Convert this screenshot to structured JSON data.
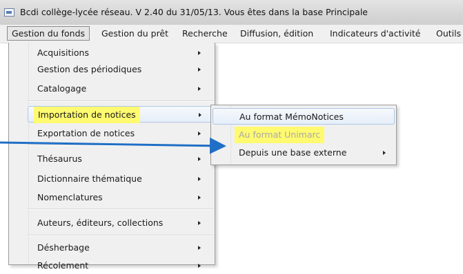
{
  "window": {
    "title": "Bcdi collège-lycée réseau. V 2.40 du 31/05/13. Vous êtes dans la base Principale",
    "icon": "app-icon"
  },
  "menubar": {
    "items": [
      {
        "label": "Gestion du fonds"
      },
      {
        "label": "Gestion du prêt"
      },
      {
        "label": "Recherche"
      },
      {
        "label": "Diffusion, édition"
      },
      {
        "label": "Indicateurs d'activité"
      },
      {
        "label": "Outils"
      }
    ]
  },
  "dropdown": {
    "items": [
      {
        "label": "Acquisitions",
        "submenu": true
      },
      {
        "label": "Gestion des périodiques",
        "submenu": true
      },
      {
        "label": "Catalogage",
        "submenu": true
      },
      {
        "label": "Importation de notices",
        "submenu": true,
        "highlighted": true
      },
      {
        "label": "Exportation de notices",
        "submenu": true
      },
      {
        "label": "Thésaurus",
        "submenu": true
      },
      {
        "label": "Dictionnaire thématique",
        "submenu": true
      },
      {
        "label": "Nomenclatures",
        "submenu": true
      },
      {
        "label": "Auteurs, éditeurs, collections",
        "submenu": true
      },
      {
        "label": "Désherbage",
        "submenu": true
      },
      {
        "label": "Récolement",
        "submenu": true
      }
    ]
  },
  "submenu": {
    "items": [
      {
        "label": "Au format MémoNotices"
      },
      {
        "label": "Au format Unimarc",
        "disabled": true
      },
      {
        "label": "Depuis une base externe",
        "submenu": true
      }
    ]
  },
  "annotation": {
    "arrow_color": "#1f6fc6",
    "highlight_color": "#fffa70"
  }
}
